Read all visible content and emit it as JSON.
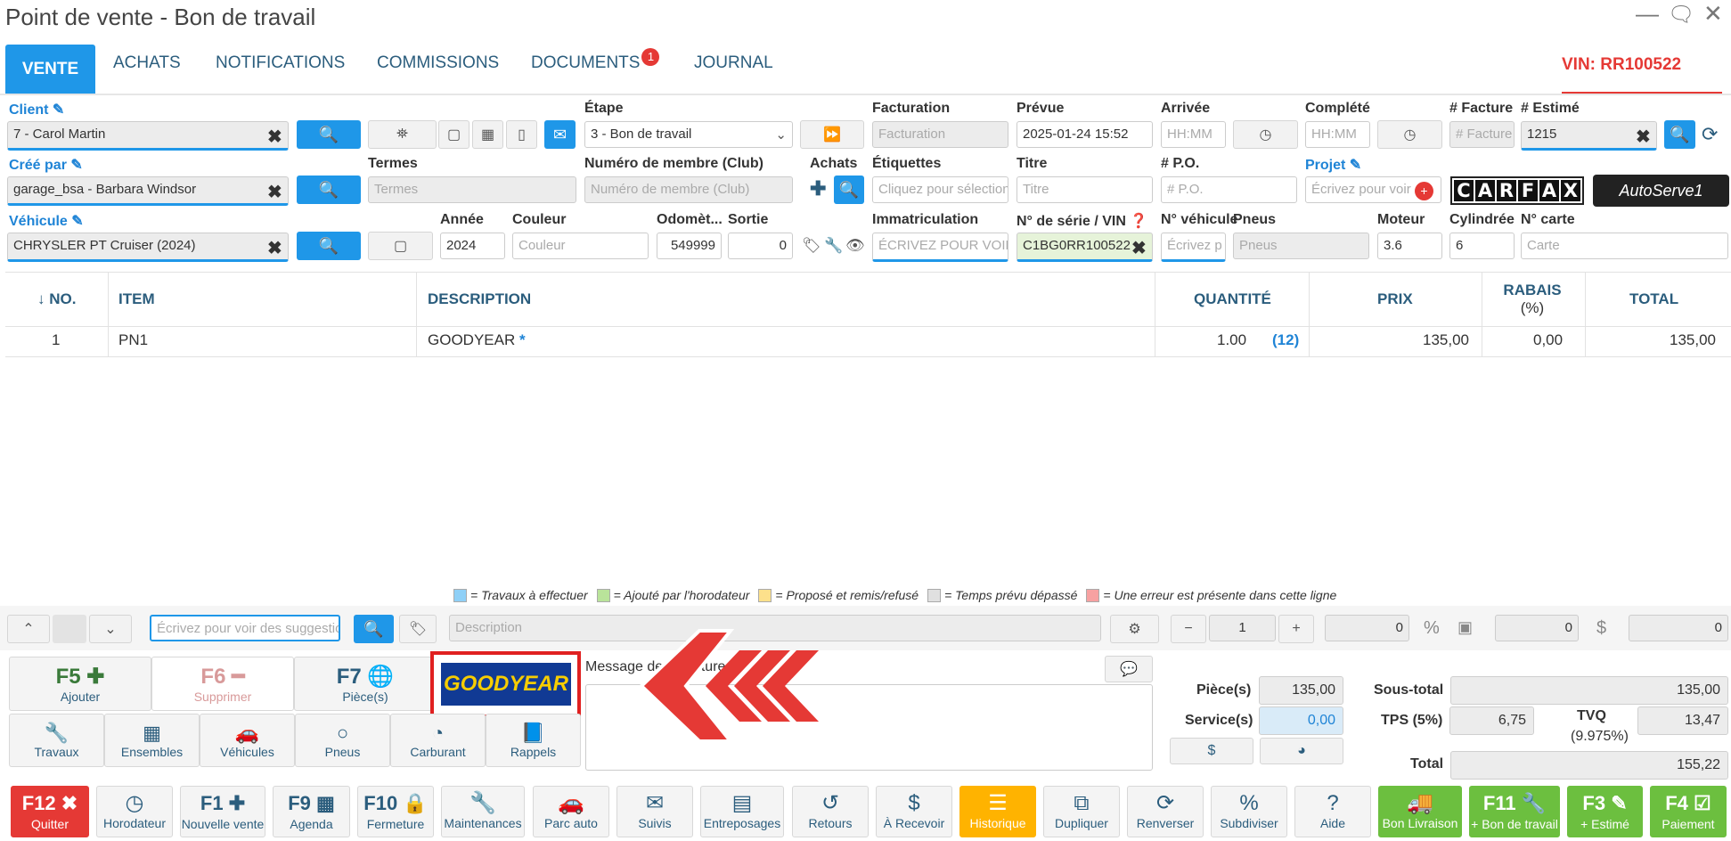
{
  "window": {
    "title": "Point de vente - Bon de travail"
  },
  "tabs": [
    {
      "label": "VENTE"
    },
    {
      "label": "ACHATS"
    },
    {
      "label": "NOTIFICATIONS"
    },
    {
      "label": "COMMISSIONS"
    },
    {
      "label": "DOCUMENTS",
      "badge": "1"
    },
    {
      "label": "JOURNAL"
    }
  ],
  "vin_tab": "VIN: RR100522",
  "form": {
    "client_label": "Client",
    "client_value": "7 - Carol Martin",
    "etape_label": "Étape",
    "etape_value": "3 - Bon de travail",
    "facturation_label": "Facturation",
    "facturation_placeholder": "Facturation",
    "prevue_label": "Prévue",
    "prevue_value": "2025-01-24 15:52",
    "arrivee_label": "Arrivée",
    "arrivee_placeholder": "HH:MM",
    "complete_label": "Complété",
    "complete_placeholder": "HH:MM",
    "facture_label": "# Facture",
    "facture_placeholder": "# Facture",
    "estime_label": "# Estimé",
    "estime_value": "1215",
    "cree_label": "Créé par",
    "cree_value": "garage_bsa - Barbara Windsor",
    "termes_label": "Termes",
    "termes_placeholder": "Termes",
    "membre_label": "Numéro de membre (Club)",
    "membre_placeholder": "Numéro de membre (Club)",
    "achats_label": "Achats",
    "etiquettes_label": "Étiquettes",
    "etiquettes_placeholder": "Cliquez pour sélectionner",
    "titre_label": "Titre",
    "titre_placeholder": "Titre",
    "po_label": "# P.O.",
    "po_placeholder": "# P.O.",
    "projet_label": "Projet",
    "projet_placeholder": "Écrivez pour voir",
    "vehicule_label": "Véhicule",
    "vehicule_value": "CHRYSLER PT Cruiser (2024)",
    "annee_label": "Année",
    "annee_value": "2024",
    "couleur_label": "Couleur",
    "couleur_placeholder": "Couleur",
    "odometre_label": "Odomèt...",
    "odometre_value": "549999",
    "sortie_label": "Sortie",
    "sortie_value": "0",
    "immat_label": "Immatriculation",
    "immat_placeholder": "ÉCRIVEZ POUR VOIR",
    "vin_label": "N° de série / VIN",
    "vin_value": "C1BG0RR100522",
    "nveh_label": "N° véhicule",
    "nveh_placeholder": "Écrivez p",
    "pneus_label": "Pneus",
    "pneus_placeholder": "Pneus",
    "moteur_label": "Moteur",
    "moteur_value": "3.6",
    "cyl_label": "Cylindrée",
    "cyl_value": "6",
    "carte_label": "N° carte",
    "carte_placeholder": "Carte"
  },
  "logos": {
    "carfax": [
      "C",
      "A",
      "R",
      "F",
      "A",
      "X"
    ],
    "autoserve": "AutoServe1"
  },
  "table": {
    "headers": {
      "no": "↓ NO.",
      "item": "ITEM",
      "description": "DESCRIPTION",
      "quantite": "QUANTITÉ",
      "prix": "PRIX",
      "rabais": "RABAIS",
      "rabais_unit": "(%)",
      "total": "TOTAL"
    },
    "rows": [
      {
        "no": "1",
        "item": "PN1",
        "description": "GOODYEAR",
        "star": "*",
        "quantite": "1.00",
        "stock": "(12)",
        "prix": "135,00",
        "rabais": "0,00",
        "total": "135,00"
      }
    ]
  },
  "legend": [
    {
      "color": "#8fd0f7",
      "text": "= Travaux à effectuer"
    },
    {
      "color": "#b9e39a",
      "text": "= Ajouté par l'horodateur"
    },
    {
      "color": "#fde08b",
      "text": "= Proposé et remis/refusé"
    },
    {
      "color": "#e0e0e0",
      "text": "= Temps prévu dépassé"
    },
    {
      "color": "#f7a1a1",
      "text": "= Une erreur est présente dans cette ligne"
    }
  ],
  "entry": {
    "search_placeholder": "Écrivez pour voir des suggestions",
    "description_placeholder": "Description",
    "qty": "1",
    "v1": "0",
    "v2": "0",
    "v3": "0"
  },
  "actions": {
    "f5": {
      "key": "F5",
      "label": "Ajouter"
    },
    "f6": {
      "key": "F6",
      "label": "Supprimer"
    },
    "f7": {
      "key": "F7",
      "label": "Pièce(s)"
    },
    "travaux": "Travaux",
    "ensembles": "Ensembles",
    "vehicules": "Véhicules",
    "pneus": "Pneus",
    "carburant": "Carburant",
    "rappels": "Rappels",
    "message_label": "Message de la facture",
    "brand_logo": "GOODYEAR"
  },
  "summary": {
    "pieces_label": "Pièce(s)",
    "pieces": "135,00",
    "service_label": "Service(s)",
    "service": "0,00",
    "soustotal_label": "Sous-total",
    "soustotal": "135,00",
    "tps_label": "TPS (5%)",
    "tps": "6,75",
    "tvq_label": "TVQ",
    "tvq_rate": "(9.975%)",
    "tvq": "13,47",
    "total_label": "Total",
    "total": "155,22"
  },
  "bottom_buttons": [
    {
      "key": "F12",
      "icon": "✖",
      "label": "Quitter",
      "style": "red"
    },
    {
      "icon": "◷",
      "label": "Horodateur"
    },
    {
      "key": "F1",
      "icon": "✚",
      "label": "Nouvelle vente"
    },
    {
      "key": "F9",
      "icon": "▦",
      "label": "Agenda"
    },
    {
      "key": "F10",
      "icon": "🔒",
      "label": "Fermeture"
    },
    {
      "icon": "🔧",
      "label": "Maintenances"
    },
    {
      "icon": "🚗",
      "label": "Parc auto"
    },
    {
      "icon": "✉",
      "label": "Suivis"
    },
    {
      "icon": "▤",
      "label": "Entreposages"
    },
    {
      "icon": "↺",
      "label": "Retours"
    },
    {
      "icon": "$",
      "label": "À Recevoir"
    },
    {
      "icon": "☰",
      "label": "Historique",
      "style": "orange"
    },
    {
      "icon": "⧉",
      "label": "Dupliquer"
    },
    {
      "icon": "⟳",
      "label": "Renverser"
    },
    {
      "icon": "%",
      "label": "Subdiviser"
    },
    {
      "icon": "?",
      "label": "Aide"
    },
    {
      "icon": "🚚",
      "label": "Bon Livraison",
      "style": "green"
    },
    {
      "key": "F11",
      "icon": "🔧",
      "label": "+ Bon de travail",
      "style": "green"
    },
    {
      "key": "F3",
      "icon": "✎",
      "label": "+ Estimé",
      "style": "green"
    },
    {
      "key": "F4",
      "icon": "☑",
      "label": "Paiement",
      "style": "green"
    }
  ]
}
